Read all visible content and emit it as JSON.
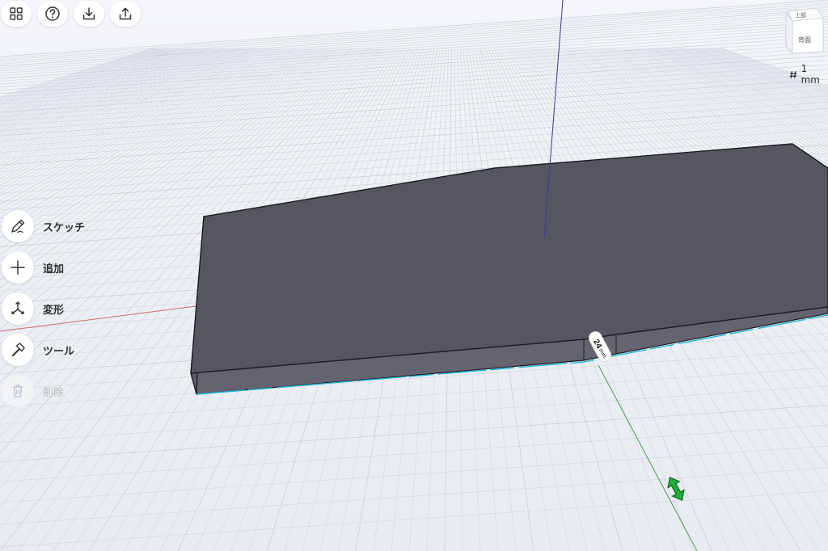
{
  "toolbar": {
    "buttons": [
      {
        "name": "grid-menu-button",
        "icon": "grid-icon"
      },
      {
        "name": "help-button",
        "icon": "question-icon"
      },
      {
        "name": "import-button",
        "icon": "download-icon"
      },
      {
        "name": "export-button",
        "icon": "share-icon"
      }
    ]
  },
  "sidebar": {
    "items": [
      {
        "label": "スケッチ",
        "icon": "pencil-icon"
      },
      {
        "label": "追加",
        "icon": "plus-icon"
      },
      {
        "label": "変形",
        "icon": "transform-icon"
      },
      {
        "label": "ツール",
        "icon": "hammer-icon"
      },
      {
        "label": "削除",
        "icon": "trash-icon",
        "disabled": true
      }
    ]
  },
  "view_cube": {
    "top_label": "上部",
    "front_label": "背面"
  },
  "grid": {
    "size_label": "1 mm"
  },
  "dimension": {
    "value": "24",
    "unit": "mm"
  },
  "colors": {
    "accent": "#1fae3c",
    "solid_top": "#55565f",
    "solid_front": "#636470",
    "axis_x": "#c8696e",
    "axis_y": "#4c9a4e",
    "axis_z": "#3a3aa0",
    "highlight_edge": "#1eb6d6"
  }
}
